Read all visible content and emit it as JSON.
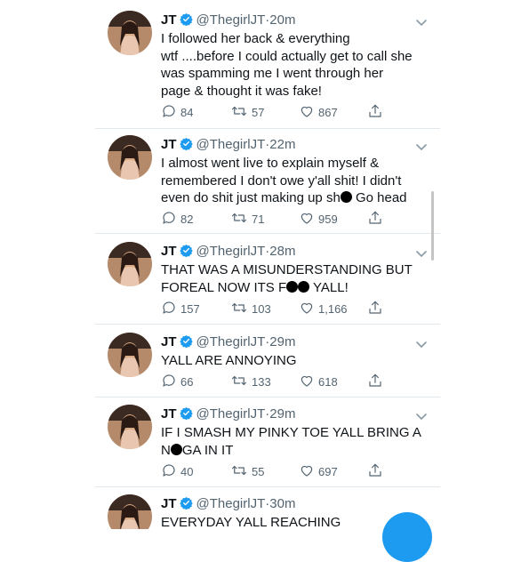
{
  "colors": {
    "accent": "#1d9bf0",
    "secondary_text": "#536471",
    "divider": "#e1e8ed"
  },
  "icons": {
    "verified": "verified-badge-icon",
    "reply": "reply-bubble-icon",
    "retweet": "retweet-arrows-icon",
    "like": "heart-outline-icon",
    "share": "share-upload-icon",
    "menu": "chevron-down-icon"
  },
  "tweets": [
    {
      "name": "JT",
      "handle": "@ThegirlJT",
      "separator": "·",
      "time": "20m",
      "text": "I followed her back & everything\nwtf ....before I could actually get to call she\nwas spamming me I went through her\npage & thought it was fake!",
      "replies": "84",
      "retweets": "57",
      "likes": "867"
    },
    {
      "name": "JT",
      "handle": "@ThegirlJT",
      "separator": "·",
      "time": "22m",
      "text_before": "I almost went live to explain myself &\nremembered I don't owe y'all shit! I didn't\neven do shit just making up sh",
      "text_after": " Go head",
      "replies": "82",
      "retweets": "71",
      "likes": "959"
    },
    {
      "name": "JT",
      "handle": "@ThegirlJT",
      "separator": "·",
      "time": "28m",
      "text_before": "THAT WAS A MISUNDERSTANDING BUT\nFOREAL NOW ITS F",
      "text_after": " YALL!",
      "replies": "157",
      "retweets": "103",
      "likes": "1,166"
    },
    {
      "name": "JT",
      "handle": "@ThegirlJT",
      "separator": "·",
      "time": "29m",
      "text": "YALL ARE ANNOYING",
      "replies": "66",
      "retweets": "133",
      "likes": "618"
    },
    {
      "name": "JT",
      "handle": "@ThegirlJT",
      "separator": "·",
      "time": "29m",
      "text_before": "IF I SMASH MY PINKY TOE YALL BRING A\nN",
      "text_after": "GA IN IT",
      "replies": "40",
      "retweets": "55",
      "likes": "697"
    },
    {
      "name": "JT",
      "handle": "@ThegirlJT",
      "separator": "·",
      "time": "30m",
      "text": "EVERYDAY YALL REACHING"
    }
  ]
}
